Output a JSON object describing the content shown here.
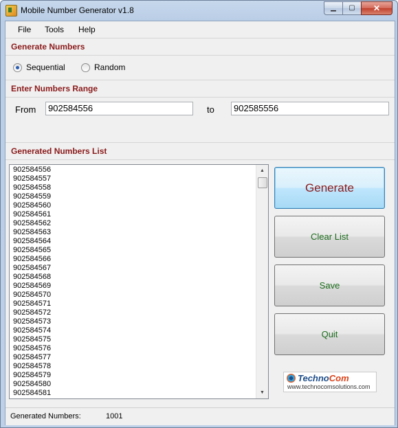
{
  "window": {
    "title": "Mobile Number Generator v1.8"
  },
  "title_buttons": {
    "minimize": "▁",
    "maximize": "▢",
    "close": "✕"
  },
  "menu": [
    "File",
    "Tools",
    "Help"
  ],
  "sections": {
    "generate": "Generate Numbers",
    "range": "Enter Numbers Range",
    "list": "Generated Numbers List"
  },
  "mode": {
    "options": [
      "Sequential",
      "Random"
    ],
    "selected": "Sequential"
  },
  "range": {
    "from_label": "From",
    "from_value": "902584556",
    "to_label": "to",
    "to_value": "902585556"
  },
  "list_items": [
    "902584556",
    "902584557",
    "902584558",
    "902584559",
    "902584560",
    "902584561",
    "902584562",
    "902584563",
    "902584564",
    "902584565",
    "902584566",
    "902584567",
    "902584568",
    "902584569",
    "902584570",
    "902584571",
    "902584572",
    "902584573",
    "902584574",
    "902584575",
    "902584576",
    "902584577",
    "902584578",
    "902584579",
    "902584580",
    "902584581"
  ],
  "scrollbar": {
    "up": "▲",
    "down": "▼"
  },
  "buttons": {
    "generate": "Generate",
    "clear": "Clear List",
    "save": "Save",
    "quit": "Quit"
  },
  "button_colors": {
    "generate": "#8b1a1a",
    "other": "#1a6b1a"
  },
  "logo": {
    "brand_a": "Techno",
    "brand_b": "Com",
    "url": "www.technocomsolutions.com"
  },
  "status": {
    "label": "Generated Numbers:",
    "value": "1001"
  }
}
